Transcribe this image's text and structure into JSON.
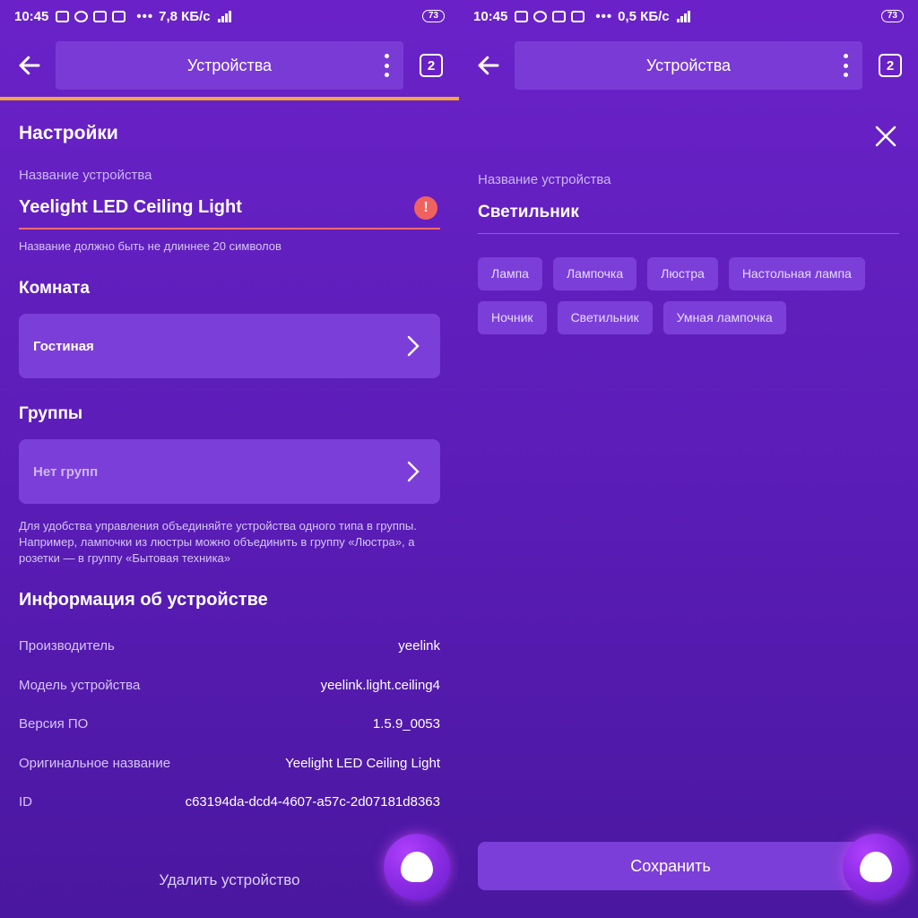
{
  "status_left": {
    "time": "10:45",
    "speed": "7,8 КБ/с",
    "battery": "73"
  },
  "status_right": {
    "time": "10:45",
    "speed": "0,5 КБ/с",
    "battery": "73"
  },
  "appbar": {
    "title": "Устройства",
    "tabs_count": "2"
  },
  "settings": {
    "title": "Настройки",
    "name_label": "Название устройства",
    "name_value": "Yeelight LED Ceiling Light",
    "error_icon": "!",
    "name_error": "Название должно быть не длиннее 20 символов",
    "room_title": "Комната",
    "room_value": "Гостиная",
    "groups_title": "Группы",
    "groups_value": "Нет групп",
    "groups_help_1": "Для удобства управления объединяйте устройства одного типа в группы.",
    "groups_help_2": "Например, лампочки из люстры можно объединить в группу «Люстра», а",
    "groups_help_3": "розетки — в группу «Бытовая техника»",
    "info_title": "Информация об устройстве",
    "info": [
      {
        "k": "Производитель",
        "v": "yeelink"
      },
      {
        "k": "Модель устройства",
        "v": "yeelink.light.ceiling4"
      },
      {
        "k": "Версия ПО",
        "v": "1.5.9_0053"
      },
      {
        "k": "Оригинальное название",
        "v": "Yeelight LED Ceiling Light"
      },
      {
        "k": "ID",
        "v": "c63194da-dcd4-4607-a57c-2d07181d8363"
      }
    ],
    "delete": "Удалить устройство"
  },
  "rename": {
    "label": "Название устройства",
    "value": "Светильник",
    "suggestions": [
      "Лампа",
      "Лампочка",
      "Люстра",
      "Настольная лампа",
      "Ночник",
      "Светильник",
      "Умная лампочка"
    ],
    "save": "Сохранить"
  },
  "icons": {
    "back": "arrow-left-icon",
    "menu": "kebab-menu-icon",
    "tabs": "tabs-counter-icon",
    "close": "close-icon",
    "chevron": "chevron-right-icon",
    "assistant": "alice-assistant-icon",
    "error": "error-icon"
  },
  "colors": {
    "accent": "#7c3ed8",
    "background": "#5a1cb6",
    "error": "#f0625f",
    "highlight": "#f2a540"
  }
}
